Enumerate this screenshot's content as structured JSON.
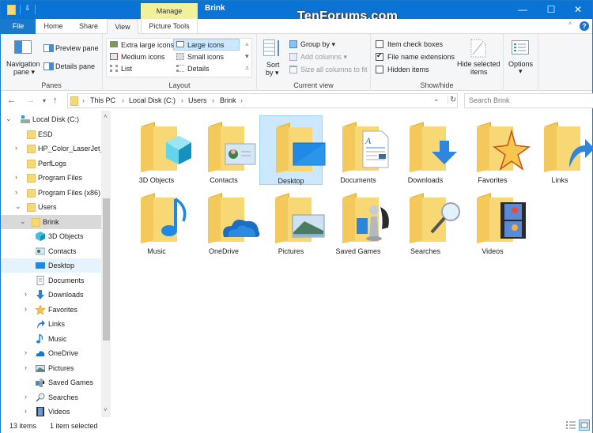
{
  "window": {
    "title": "Brink",
    "watermark": "TenForums.com",
    "contextual_tab_header": "Manage",
    "controls": {
      "minimize": "—",
      "maximize": "☐",
      "close": "✕"
    }
  },
  "colors": {
    "titlebar": "#0a74d6",
    "file_tab": "#1979ca",
    "manage_tab": "#f3f09a",
    "selection_fill": "#cce8ff",
    "selection_border": "#99d1ff",
    "folder_yellow": "#f8d775"
  },
  "tabs": [
    {
      "label": "File",
      "active": false
    },
    {
      "label": "Home",
      "active": false
    },
    {
      "label": "Share",
      "active": false
    },
    {
      "label": "View",
      "active": true
    },
    {
      "label": "Picture Tools",
      "active": false
    }
  ],
  "ribbon": {
    "panes": {
      "label": "Panes",
      "navigation_pane_line1": "Navigation",
      "navigation_pane_line2": "pane ▾",
      "preview_pane": "Preview pane",
      "details_pane": "Details pane"
    },
    "layout": {
      "label": "Layout",
      "options": [
        {
          "label": "Extra large icons",
          "selected": false
        },
        {
          "label": "Large icons",
          "selected": true
        },
        {
          "label": "Medium icons",
          "selected": false
        },
        {
          "label": "Small icons",
          "selected": false
        },
        {
          "label": "List",
          "selected": false
        },
        {
          "label": "Details",
          "selected": false
        }
      ]
    },
    "current_view": {
      "label": "Current view",
      "sort_by_line1": "Sort",
      "sort_by_line2": "by ▾",
      "group_by": "Group by ▾",
      "add_columns": "Add columns ▾",
      "size_all_columns": "Size all columns to fit"
    },
    "show_hide": {
      "label": "Show/hide",
      "item_check_boxes": {
        "label": "Item check boxes",
        "checked": false
      },
      "file_name_extensions": {
        "label": "File name extensions",
        "checked": true
      },
      "hidden_items": {
        "label": "Hidden items",
        "checked": false
      },
      "hide_selected_line1": "Hide selected",
      "hide_selected_line2": "items"
    },
    "options": {
      "label": "Options",
      "arrow": "▾"
    }
  },
  "address": {
    "back": "←",
    "forward": "→",
    "recent": "▾",
    "up": "↑",
    "breadcrumbs": [
      "This PC",
      "Local Disk (C:)",
      "Users",
      "Brink"
    ],
    "separator": "›",
    "dropdown": "⌄",
    "refresh": "↻",
    "search_placeholder": "Search Brink"
  },
  "nav_pane": {
    "items": [
      {
        "label": "Local Disk (C:)",
        "indent": 1,
        "chevron": "⌄",
        "icon": "drive"
      },
      {
        "label": "ESD",
        "indent": 2,
        "chevron": "",
        "icon": "folder"
      },
      {
        "label": "HP_Color_LaserJet_",
        "indent": 2,
        "chevron": "›",
        "icon": "folder"
      },
      {
        "label": "PerfLogs",
        "indent": 2,
        "chevron": "",
        "icon": "folder"
      },
      {
        "label": "Program Files",
        "indent": 2,
        "chevron": "›",
        "icon": "folder"
      },
      {
        "label": "Program Files (x86)",
        "indent": 2,
        "chevron": "›",
        "icon": "folder"
      },
      {
        "label": "Users",
        "indent": 2,
        "chevron": "⌄",
        "icon": "folder"
      },
      {
        "label": "Brink",
        "indent": 3,
        "chevron": "⌄",
        "icon": "folder",
        "selected": true
      },
      {
        "label": "3D Objects",
        "indent": 4,
        "chevron": "",
        "icon": "cube"
      },
      {
        "label": "Contacts",
        "indent": 4,
        "chevron": "",
        "icon": "contact"
      },
      {
        "label": "Desktop",
        "indent": 4,
        "chevron": "",
        "icon": "desktop",
        "hover": true
      },
      {
        "label": "Documents",
        "indent": 4,
        "chevron": "",
        "icon": "document"
      },
      {
        "label": "Downloads",
        "indent": 4,
        "chevron": "›",
        "icon": "download"
      },
      {
        "label": "Favorites",
        "indent": 4,
        "chevron": "›",
        "icon": "star"
      },
      {
        "label": "Links",
        "indent": 4,
        "chevron": "",
        "icon": "link"
      },
      {
        "label": "Music",
        "indent": 4,
        "chevron": "",
        "icon": "music"
      },
      {
        "label": "OneDrive",
        "indent": 4,
        "chevron": "›",
        "icon": "cloud"
      },
      {
        "label": "Pictures",
        "indent": 4,
        "chevron": "›",
        "icon": "picture"
      },
      {
        "label": "Saved Games",
        "indent": 4,
        "chevron": "",
        "icon": "games"
      },
      {
        "label": "Searches",
        "indent": 4,
        "chevron": "›",
        "icon": "search"
      },
      {
        "label": "Videos",
        "indent": 4,
        "chevron": "›",
        "icon": "video"
      }
    ]
  },
  "folders": [
    {
      "label": "3D Objects",
      "overlay": "cube",
      "selected": false
    },
    {
      "label": "Contacts",
      "overlay": "contact",
      "selected": false
    },
    {
      "label": "Desktop",
      "overlay": "desktop",
      "selected": true
    },
    {
      "label": "Documents",
      "overlay": "document",
      "selected": false
    },
    {
      "label": "Downloads",
      "overlay": "download",
      "selected": false
    },
    {
      "label": "Favorites",
      "overlay": "star",
      "selected": false
    },
    {
      "label": "Links",
      "overlay": "link",
      "selected": false
    },
    {
      "label": "Music",
      "overlay": "music",
      "selected": false
    },
    {
      "label": "OneDrive",
      "overlay": "cloud",
      "selected": false
    },
    {
      "label": "Pictures",
      "overlay": "picture",
      "selected": false
    },
    {
      "label": "Saved Games",
      "overlay": "games",
      "selected": false
    },
    {
      "label": "Searches",
      "overlay": "search",
      "selected": false
    },
    {
      "label": "Videos",
      "overlay": "video",
      "selected": false
    }
  ],
  "status": {
    "item_count": "13 items",
    "selection": "1 item selected"
  }
}
